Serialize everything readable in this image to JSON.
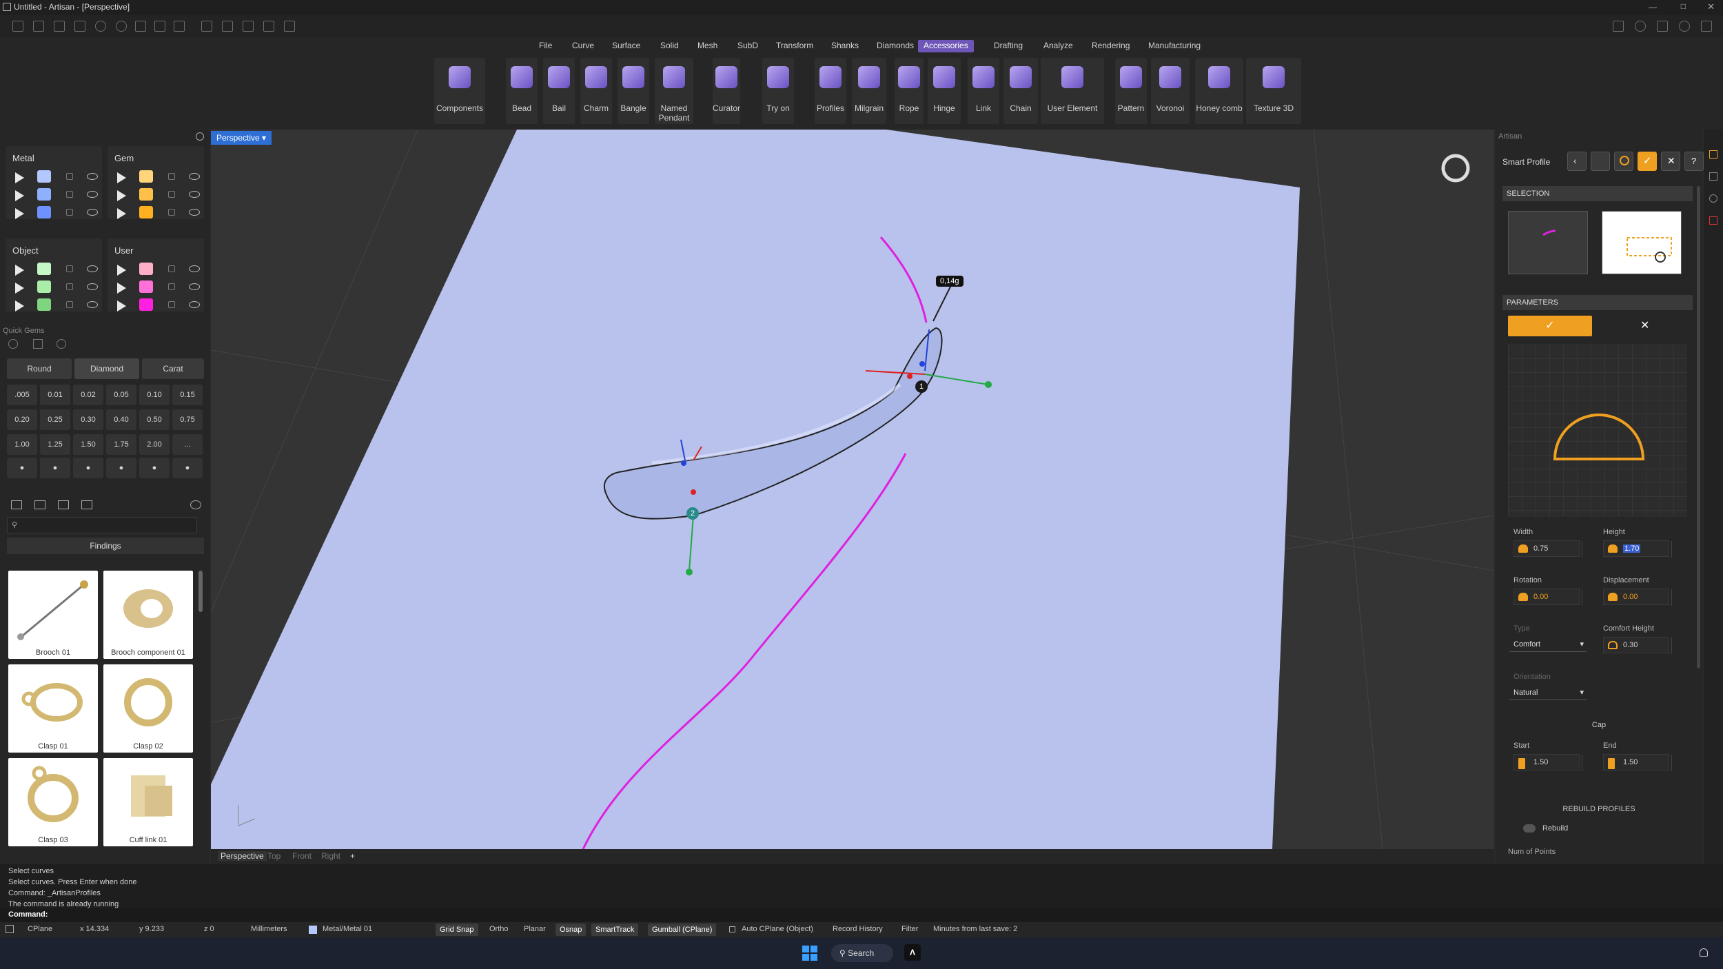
{
  "window": {
    "title": "Untitled - Artisan - [Perspective]"
  },
  "menu": [
    "File",
    "Curve",
    "Surface",
    "Solid",
    "Mesh",
    "SubD",
    "Transform",
    "Shanks",
    "Diamonds",
    "Accessories",
    "Drafting",
    "Analyze",
    "Rendering",
    "Manufacturing"
  ],
  "menu_active": "Accessories",
  "ribbon": [
    "Components",
    "Bead",
    "Bail",
    "Charm",
    "Bangle",
    "Named\nPendant",
    "Curator",
    "Try on",
    "Profiles",
    "Milgrain",
    "Rope",
    "Hinge",
    "Link",
    "Chain",
    "User Element",
    "Pattern",
    "Voronoi",
    "Honey comb",
    "Texture 3D"
  ],
  "layers": {
    "metal": {
      "title": "Metal",
      "colors": [
        "#b3c7ff",
        "#8fb0ff",
        "#6f90ff"
      ]
    },
    "gem": {
      "title": "Gem",
      "colors": [
        "#ffd47a",
        "#ffc04a",
        "#ffb020"
      ]
    },
    "object": {
      "title": "Object",
      "colors": [
        "#c6f7c6",
        "#a8eda8",
        "#7fd47f"
      ]
    },
    "user": {
      "title": "User",
      "colors": [
        "#ffb0c8",
        "#ff70d8",
        "#ff20e0"
      ]
    }
  },
  "quick_gems": {
    "title": "Quick Gems",
    "shape_buttons": [
      "Round",
      "Diamond",
      "Carat"
    ],
    "sizes": [
      ".005",
      "0.01",
      "0.02",
      "0.05",
      "0.10",
      "0.15",
      "0.20",
      "0.25",
      "0.30",
      "0.40",
      "0.50",
      "0.75",
      "1.00",
      "1.25",
      "1.50",
      "1.75",
      "2.00",
      "..."
    ]
  },
  "findings": {
    "title": "Findings",
    "items": [
      "Brooch 01",
      "Brooch component 01",
      "Clasp 01",
      "Clasp 02",
      "Clasp 03",
      "Cuff link 01"
    ]
  },
  "viewport": {
    "label": "Perspective",
    "weight_tag": "0,14g",
    "point1": "1",
    "point2": "2",
    "tabs": [
      "Perspective",
      "Top",
      "Front",
      "Right"
    ]
  },
  "right": {
    "panel_title": "Artisan",
    "smart_profile": "Smart Profile",
    "selection": "SELECTION",
    "parameters": "PARAMETERS",
    "width_label": "Width",
    "width": "0.75",
    "height_label": "Height",
    "height": "1.70",
    "rotation_label": "Rotation",
    "rotation": "0.00",
    "displacement_label": "Displacement",
    "displacement": "0.00",
    "type_label": "Type",
    "type": "Comfort",
    "comfort_label": "Comfort Height",
    "comfort": "0.30",
    "orientation_label": "Orientation",
    "orientation": "Natural",
    "cap": "Cap",
    "start_label": "Start",
    "start": "1.50",
    "end_label": "End",
    "end": "1.50",
    "rebuild_profiles": "REBUILD PROFILES",
    "rebuild": "Rebuild",
    "num_points": "Num of Points"
  },
  "command_history": [
    "Select curves",
    "Select curves. Press Enter when done",
    "Command: _ArtisanProfiles",
    "The command is already running"
  ],
  "command_prompt": "Command:",
  "status": {
    "cplane": "CPlane",
    "x": "x 14.334",
    "y": "y 9.233",
    "z": "z 0",
    "units": "Millimeters",
    "layer": "Metal/Metal 01",
    "grid_snap": "Grid Snap",
    "ortho": "Ortho",
    "planar": "Planar",
    "osnap": "Osnap",
    "smarttrack": "SmartTrack",
    "gumball": "Gumball (CPlane)",
    "auto_cplane": "Auto CPlane (Object)",
    "record_history": "Record History",
    "filter": "Filter",
    "minutes": "Minutes from last save: 2"
  },
  "taskbar": {
    "search": "Search"
  },
  "colors": {
    "accent": "#6d56b8",
    "orange": "#f0a020",
    "magenta": "#e020e0",
    "plane": "#b8c2ec"
  }
}
